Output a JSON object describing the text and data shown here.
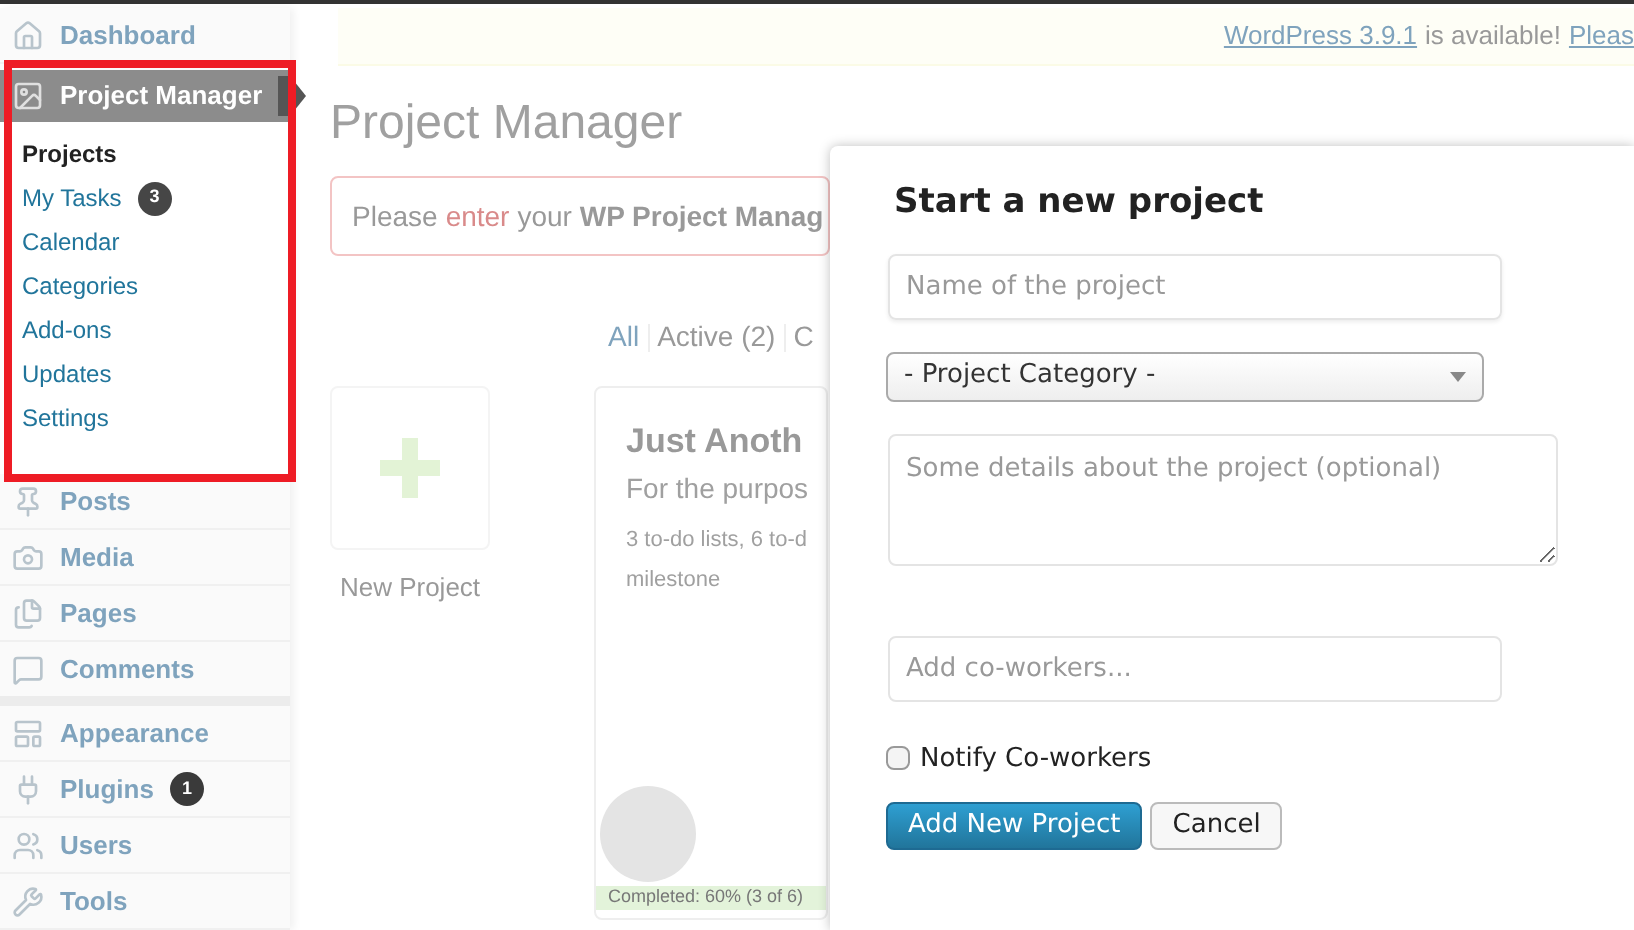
{
  "update_notice": {
    "version_link": "WordPress 3.9.1",
    "text": "is available!",
    "action_link": "Pleas"
  },
  "sidebar": {
    "items": [
      {
        "label": "Dashboard"
      },
      {
        "label": "Project Manager",
        "current": true,
        "submenu": [
          {
            "label": "Projects",
            "selected": true
          },
          {
            "label": "My Tasks",
            "selected": false,
            "badge": "3"
          },
          {
            "label": "Calendar",
            "selected": false
          },
          {
            "label": "Categories",
            "selected": false
          },
          {
            "label": "Add-ons",
            "selected": false
          },
          {
            "label": "Updates",
            "selected": false
          },
          {
            "label": "Settings",
            "selected": false
          }
        ]
      },
      {
        "label": "Posts"
      },
      {
        "label": "Media"
      },
      {
        "label": "Pages"
      },
      {
        "label": "Comments",
        "separator_after": true
      },
      {
        "label": "Appearance"
      },
      {
        "label": "Plugins",
        "badge": "1"
      },
      {
        "label": "Users"
      },
      {
        "label": "Tools"
      }
    ]
  },
  "page": {
    "title": "Project Manager",
    "error_notice": {
      "before": "Please",
      "link": "enter",
      "after": "your **WP Project Manag**"
    },
    "filters": [
      {
        "label": "All"
      },
      {
        "label": "Active (2)"
      },
      {
        "label": "C"
      }
    ],
    "new_project_label": "New Project",
    "project_card": {
      "title": "Just Anoth",
      "description": "For the purpos",
      "stats": "3 to-do lists, 6 to-d",
      "stats_2": "milestone",
      "progress": "Completed: 60% (3 of 6)"
    }
  },
  "dialog": {
    "title": "Start a new project",
    "name_placeholder": "Name of the project",
    "category": "- Project Category -",
    "details_placeholder": "Some details about the project (optional)",
    "coworkers_placeholder": "Add co-workers...",
    "notify": {
      "label": "Notify Co-workers",
      "checked": false
    },
    "buttons": [
      {
        "label": "Add New Project",
        "kind": "primary"
      },
      {
        "label": "Cancel",
        "kind": "secondary"
      }
    ]
  }
}
